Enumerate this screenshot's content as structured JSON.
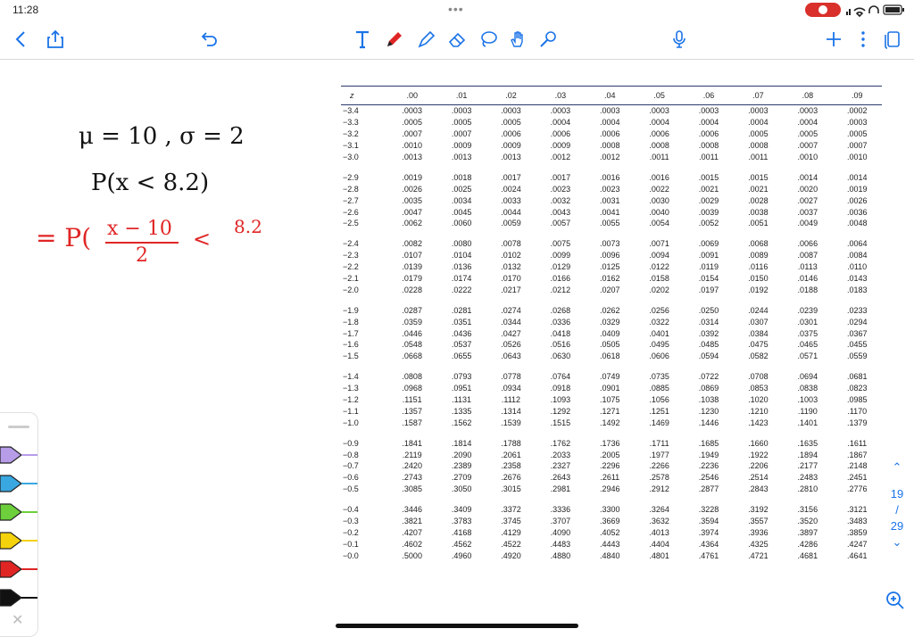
{
  "status": {
    "time": "11:28",
    "dots": "•••"
  },
  "toolbar": {
    "items": [
      "back-icon",
      "share-icon",
      "undo-icon",
      "text-tool-icon",
      "pen-tool-icon",
      "highlighter-icon",
      "eraser-icon",
      "lasso-icon",
      "hand-icon",
      "laser-icon",
      "microphone-icon",
      "add-page-icon",
      "more-icon",
      "pages-icon"
    ]
  },
  "handwriting": {
    "line1": "μ = 10  ,  σ = 2",
    "line2": "P(x < 8.2)",
    "line3_prefix": "= P(",
    "line3_num": "x − 10",
    "line3_den": "2",
    "line3_lt": "<",
    "line3_rhs": "8.2"
  },
  "table": {
    "header": [
      "z",
      ".00",
      ".01",
      ".02",
      ".03",
      ".04",
      ".05",
      ".06",
      ".07",
      ".08",
      ".09"
    ],
    "groups": [
      [
        [
          "−3.4",
          ".0003",
          ".0003",
          ".0003",
          ".0003",
          ".0003",
          ".0003",
          ".0003",
          ".0003",
          ".0003",
          ".0002"
        ],
        [
          "−3.3",
          ".0005",
          ".0005",
          ".0005",
          ".0004",
          ".0004",
          ".0004",
          ".0004",
          ".0004",
          ".0004",
          ".0003"
        ],
        [
          "−3.2",
          ".0007",
          ".0007",
          ".0006",
          ".0006",
          ".0006",
          ".0006",
          ".0006",
          ".0005",
          ".0005",
          ".0005"
        ],
        [
          "−3.1",
          ".0010",
          ".0009",
          ".0009",
          ".0009",
          ".0008",
          ".0008",
          ".0008",
          ".0008",
          ".0007",
          ".0007"
        ],
        [
          "−3.0",
          ".0013",
          ".0013",
          ".0013",
          ".0012",
          ".0012",
          ".0011",
          ".0011",
          ".0011",
          ".0010",
          ".0010"
        ]
      ],
      [
        [
          "−2.9",
          ".0019",
          ".0018",
          ".0017",
          ".0017",
          ".0016",
          ".0016",
          ".0015",
          ".0015",
          ".0014",
          ".0014"
        ],
        [
          "−2.8",
          ".0026",
          ".0025",
          ".0024",
          ".0023",
          ".0023",
          ".0022",
          ".0021",
          ".0021",
          ".0020",
          ".0019"
        ],
        [
          "−2.7",
          ".0035",
          ".0034",
          ".0033",
          ".0032",
          ".0031",
          ".0030",
          ".0029",
          ".0028",
          ".0027",
          ".0026"
        ],
        [
          "−2.6",
          ".0047",
          ".0045",
          ".0044",
          ".0043",
          ".0041",
          ".0040",
          ".0039",
          ".0038",
          ".0037",
          ".0036"
        ],
        [
          "−2.5",
          ".0062",
          ".0060",
          ".0059",
          ".0057",
          ".0055",
          ".0054",
          ".0052",
          ".0051",
          ".0049",
          ".0048"
        ]
      ],
      [
        [
          "−2.4",
          ".0082",
          ".0080",
          ".0078",
          ".0075",
          ".0073",
          ".0071",
          ".0069",
          ".0068",
          ".0066",
          ".0064"
        ],
        [
          "−2.3",
          ".0107",
          ".0104",
          ".0102",
          ".0099",
          ".0096",
          ".0094",
          ".0091",
          ".0089",
          ".0087",
          ".0084"
        ],
        [
          "−2.2",
          ".0139",
          ".0136",
          ".0132",
          ".0129",
          ".0125",
          ".0122",
          ".0119",
          ".0116",
          ".0113",
          ".0110"
        ],
        [
          "−2.1",
          ".0179",
          ".0174",
          ".0170",
          ".0166",
          ".0162",
          ".0158",
          ".0154",
          ".0150",
          ".0146",
          ".0143"
        ],
        [
          "−2.0",
          ".0228",
          ".0222",
          ".0217",
          ".0212",
          ".0207",
          ".0202",
          ".0197",
          ".0192",
          ".0188",
          ".0183"
        ]
      ],
      [
        [
          "−1.9",
          ".0287",
          ".0281",
          ".0274",
          ".0268",
          ".0262",
          ".0256",
          ".0250",
          ".0244",
          ".0239",
          ".0233"
        ],
        [
          "−1.8",
          ".0359",
          ".0351",
          ".0344",
          ".0336",
          ".0329",
          ".0322",
          ".0314",
          ".0307",
          ".0301",
          ".0294"
        ],
        [
          "−1.7",
          ".0446",
          ".0436",
          ".0427",
          ".0418",
          ".0409",
          ".0401",
          ".0392",
          ".0384",
          ".0375",
          ".0367"
        ],
        [
          "−1.6",
          ".0548",
          ".0537",
          ".0526",
          ".0516",
          ".0505",
          ".0495",
          ".0485",
          ".0475",
          ".0465",
          ".0455"
        ],
        [
          "−1.5",
          ".0668",
          ".0655",
          ".0643",
          ".0630",
          ".0618",
          ".0606",
          ".0594",
          ".0582",
          ".0571",
          ".0559"
        ]
      ],
      [
        [
          "−1.4",
          ".0808",
          ".0793",
          ".0778",
          ".0764",
          ".0749",
          ".0735",
          ".0722",
          ".0708",
          ".0694",
          ".0681"
        ],
        [
          "−1.3",
          ".0968",
          ".0951",
          ".0934",
          ".0918",
          ".0901",
          ".0885",
          ".0869",
          ".0853",
          ".0838",
          ".0823"
        ],
        [
          "−1.2",
          ".1151",
          ".1131",
          ".1112",
          ".1093",
          ".1075",
          ".1056",
          ".1038",
          ".1020",
          ".1003",
          ".0985"
        ],
        [
          "−1.1",
          ".1357",
          ".1335",
          ".1314",
          ".1292",
          ".1271",
          ".1251",
          ".1230",
          ".1210",
          ".1190",
          ".1170"
        ],
        [
          "−1.0",
          ".1587",
          ".1562",
          ".1539",
          ".1515",
          ".1492",
          ".1469",
          ".1446",
          ".1423",
          ".1401",
          ".1379"
        ]
      ],
      [
        [
          "−0.9",
          ".1841",
          ".1814",
          ".1788",
          ".1762",
          ".1736",
          ".1711",
          ".1685",
          ".1660",
          ".1635",
          ".1611"
        ],
        [
          "−0.8",
          ".2119",
          ".2090",
          ".2061",
          ".2033",
          ".2005",
          ".1977",
          ".1949",
          ".1922",
          ".1894",
          ".1867"
        ],
        [
          "−0.7",
          ".2420",
          ".2389",
          ".2358",
          ".2327",
          ".2296",
          ".2266",
          ".2236",
          ".2206",
          ".2177",
          ".2148"
        ],
        [
          "−0.6",
          ".2743",
          ".2709",
          ".2676",
          ".2643",
          ".2611",
          ".2578",
          ".2546",
          ".2514",
          ".2483",
          ".2451"
        ],
        [
          "−0.5",
          ".3085",
          ".3050",
          ".3015",
          ".2981",
          ".2946",
          ".2912",
          ".2877",
          ".2843",
          ".2810",
          ".2776"
        ]
      ],
      [
        [
          "−0.4",
          ".3446",
          ".3409",
          ".3372",
          ".3336",
          ".3300",
          ".3264",
          ".3228",
          ".3192",
          ".3156",
          ".3121"
        ],
        [
          "−0.3",
          ".3821",
          ".3783",
          ".3745",
          ".3707",
          ".3669",
          ".3632",
          ".3594",
          ".3557",
          ".3520",
          ".3483"
        ],
        [
          "−0.2",
          ".4207",
          ".4168",
          ".4129",
          ".4090",
          ".4052",
          ".4013",
          ".3974",
          ".3936",
          ".3897",
          ".3859"
        ],
        [
          "−0.1",
          ".4602",
          ".4562",
          ".4522",
          ".4483",
          ".4443",
          ".4404",
          ".4364",
          ".4325",
          ".4286",
          ".4247"
        ],
        [
          "−0.0",
          ".5000",
          ".4960",
          ".4920",
          ".4880",
          ".4840",
          ".4801",
          ".4761",
          ".4721",
          ".4681",
          ".4641"
        ]
      ]
    ]
  },
  "pager": {
    "current": "19",
    "sep": "/",
    "total": "29"
  },
  "pens": [
    {
      "name": "purple-pen-icon",
      "color": "#b79ce8"
    },
    {
      "name": "blue-pen-icon",
      "color": "#39a7e0"
    },
    {
      "name": "green-pen-icon",
      "color": "#6ccf3b"
    },
    {
      "name": "yellow-pen-icon",
      "color": "#f4d20c"
    },
    {
      "name": "red-pen-icon",
      "color": "#e02525"
    },
    {
      "name": "black-pen-icon",
      "color": "#111111"
    }
  ],
  "colors": {
    "accent": "#1a73e8",
    "ink_black": "#111111",
    "ink_red": "#e02525",
    "record": "#d9302b"
  }
}
